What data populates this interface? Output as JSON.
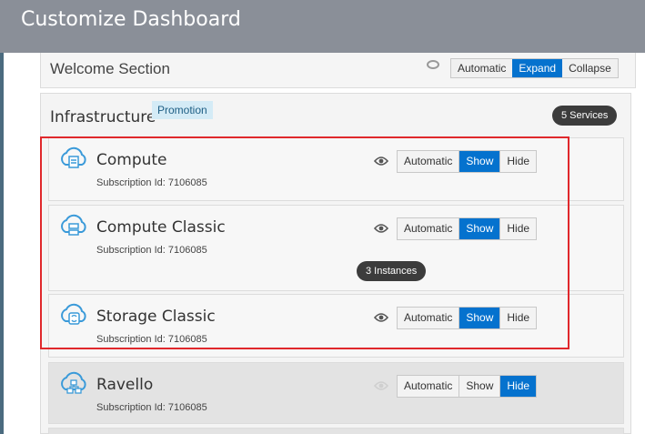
{
  "dialog": {
    "title": "Customize Dashboard"
  },
  "welcome": {
    "title": "Welcome Section",
    "buttons": [
      "Automatic",
      "Expand",
      "Collapse"
    ],
    "selected": "Expand"
  },
  "infrastructure": {
    "title": "Infrastructure",
    "badge": "Promotion",
    "count_label": "5 Services",
    "services": [
      {
        "name": "Compute",
        "subscription": "Subscription Id: 7106085",
        "icon": "cloud-compute-icon",
        "buttons": [
          "Automatic",
          "Show",
          "Hide"
        ],
        "selected": "Show",
        "instances": ""
      },
      {
        "name": "Compute Classic",
        "subscription": "Subscription Id: 7106085",
        "icon": "cloud-compute-classic-icon",
        "buttons": [
          "Automatic",
          "Show",
          "Hide"
        ],
        "selected": "Show",
        "instances": "3 Instances"
      },
      {
        "name": "Storage Classic",
        "subscription": "Subscription Id: 7106085",
        "icon": "cloud-storage-icon",
        "buttons": [
          "Automatic",
          "Show",
          "Hide"
        ],
        "selected": "Show",
        "instances": ""
      },
      {
        "name": "Ravello",
        "subscription": "Subscription Id: 7106085",
        "icon": "cloud-network-icon",
        "buttons": [
          "Automatic",
          "Show",
          "Hide"
        ],
        "selected": "Hide",
        "instances": ""
      }
    ]
  },
  "colors": {
    "accent": "#0572ce",
    "highlight": "#e0282c",
    "header": "#8a8f98"
  }
}
